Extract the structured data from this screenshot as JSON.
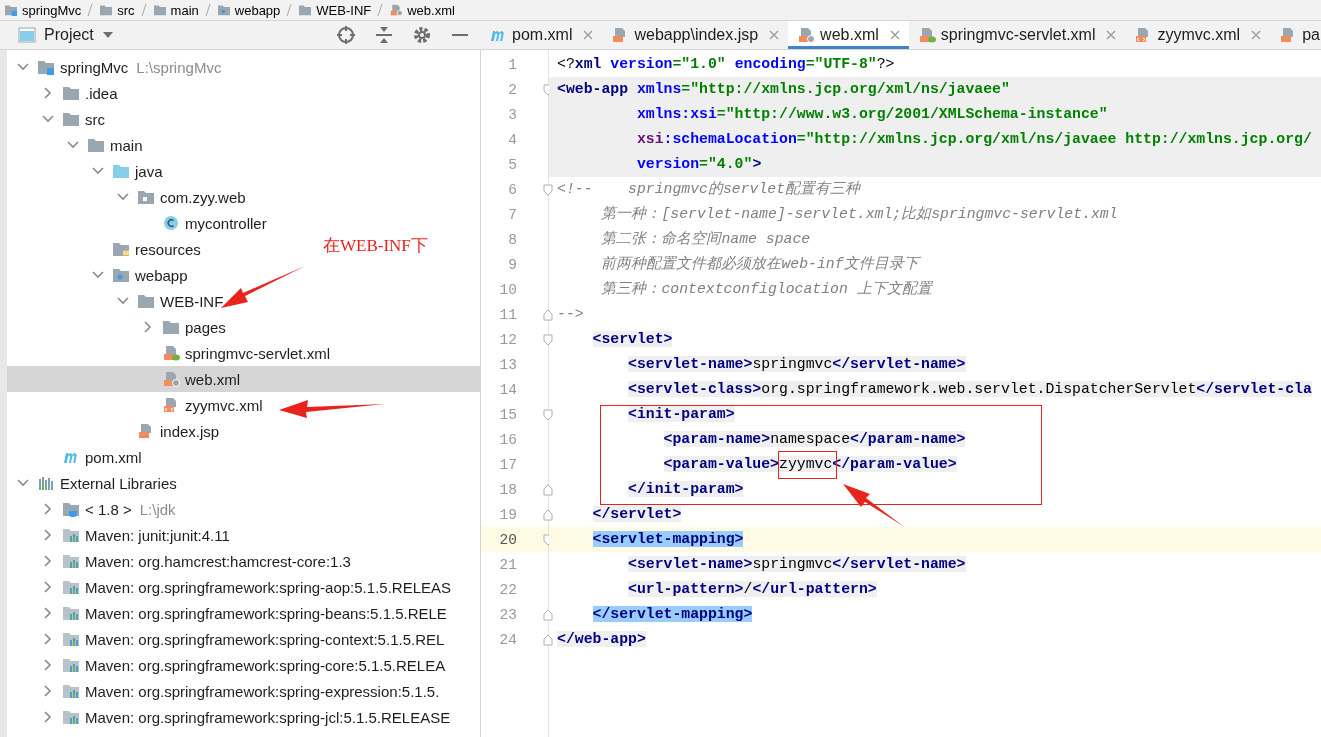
{
  "breadcrumb": [
    {
      "label": "springMvc",
      "kind": "module"
    },
    {
      "label": "src",
      "kind": "folder"
    },
    {
      "label": "main",
      "kind": "folder"
    },
    {
      "label": "webapp",
      "kind": "web-folder"
    },
    {
      "label": "WEB-INF",
      "kind": "folder"
    },
    {
      "label": "web.xml",
      "kind": "xml-web"
    }
  ],
  "project_panel": {
    "title": "Project"
  },
  "tabs": [
    {
      "label": "pom.xml",
      "kind": "maven",
      "selected": false,
      "closable": true
    },
    {
      "label": "webapp\\index.jsp",
      "kind": "jsp",
      "selected": false,
      "closable": true
    },
    {
      "label": "web.xml",
      "kind": "xml-web",
      "selected": true,
      "closable": true
    },
    {
      "label": "springmvc-servlet.xml",
      "kind": "xml-spring",
      "selected": false,
      "closable": true
    },
    {
      "label": "zyymvc.xml",
      "kind": "xml",
      "selected": false,
      "closable": true
    },
    {
      "label": "pa",
      "kind": "jsp",
      "selected": false,
      "closable": false
    }
  ],
  "tree": [
    {
      "label": "springMvc",
      "path": "L:\\springMvc",
      "kind": "module",
      "expanded": true,
      "selected": false,
      "children": [
        {
          "label": ".idea",
          "kind": "folder",
          "expanded": false,
          "selected": false
        },
        {
          "label": "src",
          "kind": "folder",
          "expanded": true,
          "selected": false,
          "children": [
            {
              "label": "main",
              "kind": "folder",
              "expanded": true,
              "selected": false,
              "children": [
                {
                  "label": "java",
                  "kind": "source-folder",
                  "expanded": true,
                  "selected": false,
                  "children": [
                    {
                      "label": "com.zyy.web",
                      "kind": "package",
                      "expanded": true,
                      "selected": false,
                      "children": [
                        {
                          "label": "mycontroller",
                          "kind": "class",
                          "selected": false
                        }
                      ]
                    }
                  ]
                },
                {
                  "label": "resources",
                  "kind": "resources-folder",
                  "selected": false
                },
                {
                  "label": "webapp",
                  "kind": "web-folder",
                  "expanded": true,
                  "selected": false,
                  "children": [
                    {
                      "label": "WEB-INF",
                      "kind": "folder",
                      "expanded": true,
                      "selected": false,
                      "children": [
                        {
                          "label": "pages",
                          "kind": "folder",
                          "expanded": false,
                          "selected": false
                        },
                        {
                          "label": "springmvc-servlet.xml",
                          "kind": "xml-spring",
                          "selected": false
                        },
                        {
                          "label": "web.xml",
                          "kind": "xml-web",
                          "selected": true
                        },
                        {
                          "label": "zyymvc.xml",
                          "kind": "xml",
                          "selected": false
                        }
                      ]
                    },
                    {
                      "label": "index.jsp",
                      "kind": "jsp",
                      "selected": false
                    }
                  ]
                }
              ]
            }
          ]
        },
        {
          "label": "pom.xml",
          "kind": "maven",
          "selected": false
        }
      ]
    },
    {
      "label": "External Libraries",
      "kind": "library",
      "expanded": true,
      "selected": false,
      "children": [
        {
          "label": "< 1.8 >",
          "path": "L:\\jdk",
          "kind": "jdk",
          "expanded": false,
          "selected": false
        },
        {
          "label": "Maven: junit:junit:4.11",
          "kind": "library-folder",
          "expanded": false,
          "selected": false
        },
        {
          "label": "Maven: org.hamcrest:hamcrest-core:1.3",
          "kind": "library-folder",
          "expanded": false,
          "selected": false
        },
        {
          "label": "Maven: org.springframework:spring-aop:5.1.5.RELEAS",
          "kind": "library-folder",
          "expanded": false,
          "selected": false
        },
        {
          "label": "Maven: org.springframework:spring-beans:5.1.5.RELE",
          "kind": "library-folder",
          "expanded": false,
          "selected": false
        },
        {
          "label": "Maven: org.springframework:spring-context:5.1.5.REL",
          "kind": "library-folder",
          "expanded": false,
          "selected": false
        },
        {
          "label": "Maven: org.springframework:spring-core:5.1.5.RELEA",
          "kind": "library-folder",
          "expanded": false,
          "selected": false
        },
        {
          "label": "Maven: org.springframework:spring-expression:5.1.5.",
          "kind": "library-folder",
          "expanded": false,
          "selected": false
        },
        {
          "label": "Maven: org.springframework:spring-jcl:5.1.5.RELEASE",
          "kind": "library-folder",
          "expanded": false,
          "selected": false
        }
      ]
    }
  ],
  "tree_note": "在WEB-INF下",
  "editor": {
    "lines": [
      {
        "number": "1",
        "kind": "plain",
        "fold_start": false,
        "fold_end": false,
        "segments": [
          {
            "kind": "punct",
            "text": "<?"
          },
          {
            "kind": "tag",
            "text": "xml "
          },
          {
            "kind": "attr",
            "text": "version"
          },
          {
            "kind": "str",
            "text": "=\"1.0\" "
          },
          {
            "kind": "attr",
            "text": "encoding"
          },
          {
            "kind": "str",
            "text": "=\"UTF-8\""
          },
          {
            "kind": "punct",
            "text": "?>"
          }
        ]
      },
      {
        "number": "2",
        "kind": "block",
        "fold_start": true,
        "fold_end": false,
        "segments": [
          {
            "kind": "tag",
            "text": "<web-app "
          },
          {
            "kind": "attr",
            "text": "xmlns"
          },
          {
            "kind": "str",
            "text": "=\"http://xmlns.jcp.org/xml/ns/javaee\""
          }
        ]
      },
      {
        "number": "3",
        "kind": "block",
        "fold_start": false,
        "fold_end": false,
        "segments": [
          {
            "kind": "attr",
            "text": "         xmlns:xsi"
          },
          {
            "kind": "str",
            "text": "=\"http://www.w3.org/2001/XMLSchema-instance\""
          }
        ]
      },
      {
        "number": "4",
        "kind": "block",
        "fold_start": false,
        "fold_end": false,
        "segments": [
          {
            "kind": "ns",
            "text": "         xsi"
          },
          {
            "kind": "attr",
            "text": ":schemaLocation"
          },
          {
            "kind": "str",
            "text": "=\"http://xmlns.jcp.org/xml/ns/javaee http://xmlns.jcp.org/"
          }
        ]
      },
      {
        "number": "5",
        "kind": "block",
        "fold_start": false,
        "fold_end": false,
        "segments": [
          {
            "kind": "attr",
            "text": "         version"
          },
          {
            "kind": "str",
            "text": "=\"4.0\""
          },
          {
            "kind": "tag",
            "text": ">"
          }
        ]
      },
      {
        "number": "6",
        "kind": "plain",
        "fold_start": true,
        "fold_end": false,
        "segments": [
          {
            "kind": "comment",
            "text": "<!--    springmvc的servlet配置有三种"
          }
        ]
      },
      {
        "number": "7",
        "kind": "plain",
        "fold_start": false,
        "fold_end": false,
        "segments": [
          {
            "kind": "comment",
            "text": "     第一种：[servlet-name]-servlet.xml;比如springmvc-servlet.xml"
          }
        ]
      },
      {
        "number": "8",
        "kind": "plain",
        "fold_start": false,
        "fold_end": false,
        "segments": [
          {
            "kind": "comment",
            "text": "     第二张：命名空间name space"
          }
        ]
      },
      {
        "number": "9",
        "kind": "plain",
        "fold_start": false,
        "fold_end": false,
        "segments": [
          {
            "kind": "comment",
            "text": "     前两种配置文件都必须放在web-inf文件目录下"
          }
        ]
      },
      {
        "number": "10",
        "kind": "plain",
        "fold_start": false,
        "fold_end": false,
        "segments": [
          {
            "kind": "comment",
            "text": "     第三种：contextconfiglocation 上下文配置"
          }
        ]
      },
      {
        "number": "11",
        "kind": "plain",
        "fold_start": false,
        "fold_end": true,
        "segments": [
          {
            "kind": "comment",
            "text": "-->"
          }
        ]
      },
      {
        "number": "12",
        "kind": "tagged",
        "fold_start": true,
        "fold_end": false,
        "segments": [
          {
            "kind": "tag",
            "text": "    <servlet>"
          }
        ]
      },
      {
        "number": "13",
        "kind": "tagged",
        "fold_start": false,
        "fold_end": false,
        "segments": [
          {
            "kind": "tag",
            "text": "        <servlet-name>"
          },
          {
            "kind": "text",
            "text": "springmvc"
          },
          {
            "kind": "tag",
            "text": "</servlet-name>"
          }
        ]
      },
      {
        "number": "14",
        "kind": "tagged",
        "fold_start": false,
        "fold_end": false,
        "segments": [
          {
            "kind": "tag",
            "text": "        <servlet-class>"
          },
          {
            "kind": "text",
            "text": "org.springframework.web.servlet.DispatcherServlet"
          },
          {
            "kind": "tag",
            "text": "</servlet-cla"
          }
        ]
      },
      {
        "number": "15",
        "kind": "tagged",
        "fold_start": true,
        "fold_end": false,
        "segments": [
          {
            "kind": "tag",
            "text": "        <init-param>"
          }
        ]
      },
      {
        "number": "16",
        "kind": "tagged",
        "fold_start": false,
        "fold_end": false,
        "segments": [
          {
            "kind": "tag",
            "text": "            <param-name>"
          },
          {
            "kind": "text",
            "text": "namespace"
          },
          {
            "kind": "tag",
            "text": "</param-name>"
          }
        ]
      },
      {
        "number": "17",
        "kind": "tagged",
        "fold_start": false,
        "fold_end": false,
        "segments": [
          {
            "kind": "tag",
            "text": "            <param-value>"
          },
          {
            "kind": "text",
            "text": "zyymvc"
          },
          {
            "kind": "tag",
            "text": "</param-value>"
          }
        ]
      },
      {
        "number": "18",
        "kind": "tagged",
        "fold_start": false,
        "fold_end": true,
        "segments": [
          {
            "kind": "tag",
            "text": "        </init-param>"
          }
        ]
      },
      {
        "number": "19",
        "kind": "tagged",
        "fold_start": false,
        "fold_end": true,
        "segments": [
          {
            "kind": "tag",
            "text": "    </servlet>"
          }
        ]
      },
      {
        "number": "20",
        "kind": "current",
        "fold_start": true,
        "fold_end": false,
        "segments": [
          {
            "kind": "match",
            "text": "    <servlet-mapping>"
          }
        ]
      },
      {
        "number": "21",
        "kind": "tagged",
        "fold_start": false,
        "fold_end": false,
        "segments": [
          {
            "kind": "tag",
            "text": "        <servlet-name>"
          },
          {
            "kind": "text",
            "text": "springmvc"
          },
          {
            "kind": "tag",
            "text": "</servlet-name>"
          }
        ]
      },
      {
        "number": "22",
        "kind": "tagged",
        "fold_start": false,
        "fold_end": false,
        "segments": [
          {
            "kind": "tag",
            "text": "        <url-pattern>"
          },
          {
            "kind": "text",
            "text": "/"
          },
          {
            "kind": "tag",
            "text": "</url-pattern>"
          }
        ]
      },
      {
        "number": "23",
        "kind": "tagged",
        "fold_start": false,
        "fold_end": true,
        "segments": [
          {
            "kind": "match",
            "text": "    </servlet-mapping>"
          }
        ]
      },
      {
        "number": "24",
        "kind": "tagged",
        "fold_start": false,
        "fold_end": true,
        "segments": [
          {
            "kind": "tag",
            "text": "</web-app>"
          }
        ]
      }
    ]
  }
}
